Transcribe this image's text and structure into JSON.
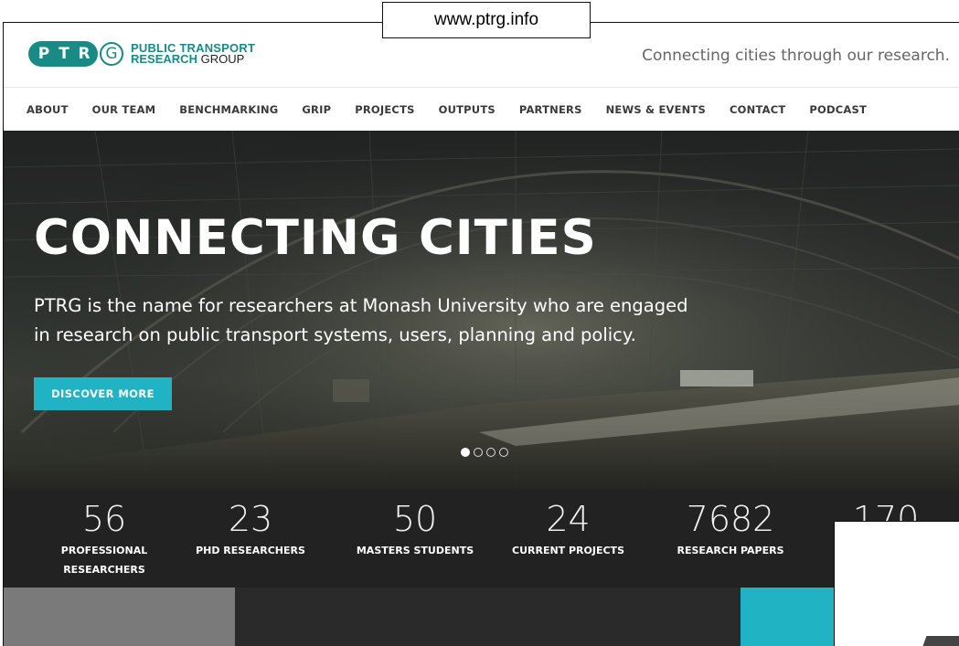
{
  "url_label": "www.ptrg.info",
  "logo": {
    "letters": [
      "P",
      "T",
      "R"
    ],
    "g": "G",
    "line1": "PUBLIC TRANSPORT",
    "line2_bold": "RESEARCH",
    "line2_normal": " GROUP",
    "brand_color": "#1a8a84"
  },
  "tagline": "Connecting cities through our research.",
  "nav": {
    "items": [
      "ABOUT",
      "OUR TEAM",
      "BENCHMARKING",
      "GRIP",
      "PROJECTS",
      "OUTPUTS",
      "PARTNERS",
      "NEWS & EVENTS",
      "CONTACT",
      "PODCAST"
    ]
  },
  "hero": {
    "title": "CONNECTING CITIES",
    "description_line1": "PTRG is the name for researchers at Monash University who are engaged",
    "description_line2": "in research on public transport systems, users, planning and policy.",
    "button_label": "DISCOVER MORE",
    "button_color": "#1fb3c4",
    "slides_total": 4,
    "slide_active": 1
  },
  "stats": [
    {
      "number": "56",
      "label_line1": "PROFESSIONAL",
      "label_line2": "RESEARCHERS"
    },
    {
      "number": "23",
      "label_line1": "PHD RESEARCHERS",
      "label_line2": ""
    },
    {
      "number": "50",
      "label_line1": "MASTERS STUDENTS",
      "label_line2": ""
    },
    {
      "number": "24",
      "label_line1": "CURRENT PROJECTS",
      "label_line2": ""
    },
    {
      "number": "7682",
      "label_line1": "RESEARCH PAPERS",
      "label_line2": ""
    },
    {
      "number": "170",
      "label_line1": "",
      "label_line2": ""
    }
  ]
}
